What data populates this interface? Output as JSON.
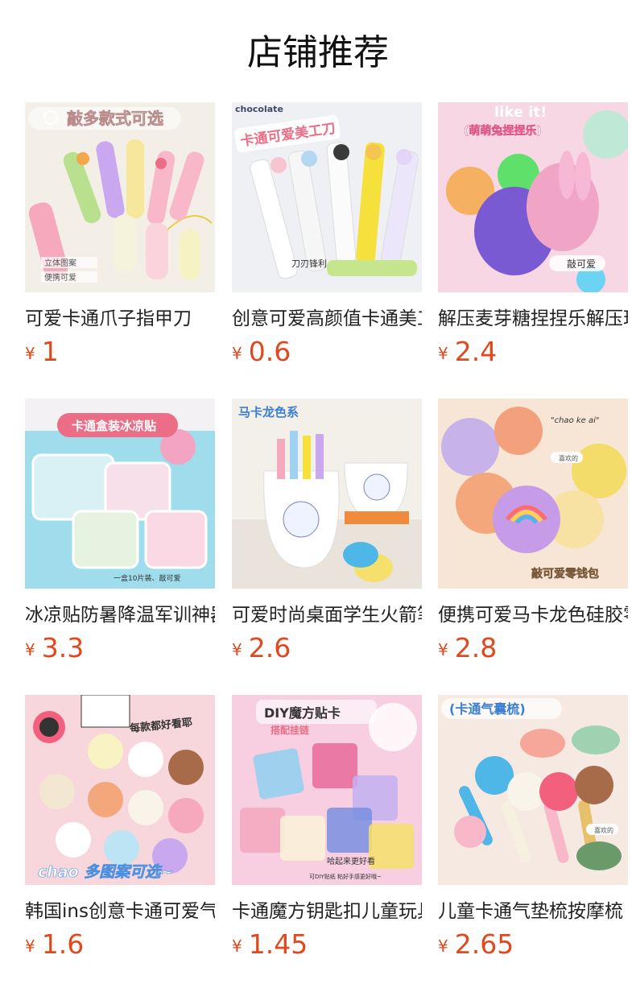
{
  "header": {
    "title": "店铺推荐"
  },
  "currency_symbol": "¥",
  "colors": {
    "price": "#e0481e",
    "title": "#111111",
    "product_name": "#222222"
  },
  "products": [
    {
      "name": "可爱卡通爪子指甲刀",
      "price": "1",
      "image_texts": [
        "敲多款式可选",
        "立体图案",
        "便携可爱"
      ]
    },
    {
      "name": "创意可爱高颜值卡通美工刀",
      "price": "0.6",
      "image_texts": [
        "卡通可爱美工刀",
        "刀刃锋利"
      ]
    },
    {
      "name": "解压麦芽糖捏捏乐解压玩具",
      "price": "2.4",
      "image_texts": [
        "like it!",
        "(萌萌兔捏捏乐)",
        "敲可爱"
      ]
    },
    {
      "name": "冰凉贴防暑降温军训神器",
      "price": "3.3",
      "image_texts": [
        "卡通盒装冰凉贴",
        "一盒10片装、敲可爱"
      ]
    },
    {
      "name": "可爱时尚桌面学生火箭笔筒",
      "price": "2.6",
      "image_texts": [
        "马卡龙色系"
      ]
    },
    {
      "name": "便携可爱马卡龙色硅胶零钱包",
      "price": "2.8",
      "image_texts": [
        "\"chao ke ai\"",
        "喜欢的",
        "敲可爱零钱包"
      ]
    },
    {
      "name": "韩国ins创意卡通可爱气囊梳",
      "price": "1.6",
      "image_texts": [
        "每款都好看耶",
        "chao 多图案可选~"
      ]
    },
    {
      "name": "卡通魔方钥匙扣儿童玩具挂件",
      "price": "1.45",
      "image_texts": [
        "DIY魔方贴卡",
        "搭配挂链",
        "哈起来更好看",
        "可DIY贴纸 粘好手感更好哦~"
      ]
    },
    {
      "name": "儿童卡通气垫梳按摩梳",
      "price": "2.65",
      "image_texts": [
        "(卡通气囊梳)",
        "喜欢的"
      ]
    }
  ]
}
